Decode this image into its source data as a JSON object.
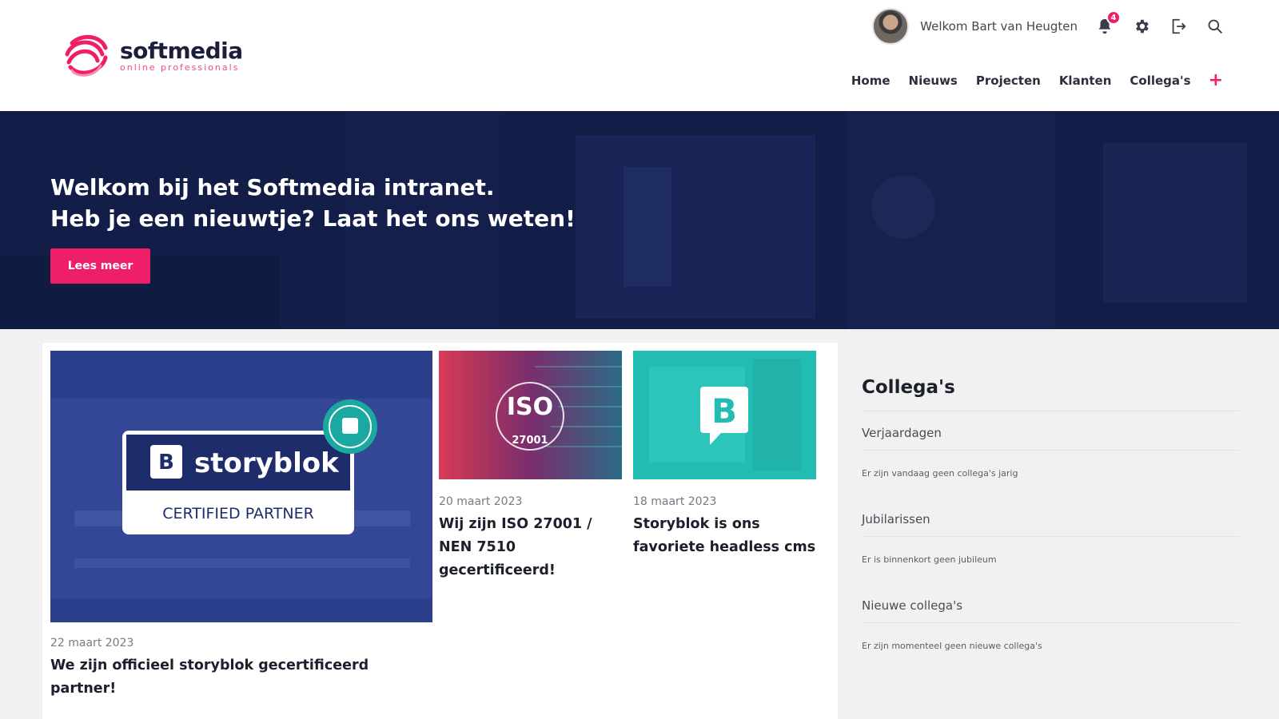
{
  "brand": {
    "name": "softmedia",
    "tagline": "online professionals",
    "accent": "#ef1e68",
    "navy": "#121d48"
  },
  "user": {
    "welcome": "Welkom Bart van Heugten",
    "notifications": "4"
  },
  "nav": {
    "items": [
      "Home",
      "Nieuws",
      "Projecten",
      "Klanten",
      "Collega's"
    ],
    "plus": "+"
  },
  "hero": {
    "line1": "Welkom bij het Softmedia intranet.",
    "line2": "Heb je een nieuwtje? Laat het ons weten!",
    "button": "Lees meer"
  },
  "news": [
    {
      "date": "22 maart 2023",
      "title": "We zijn officieel storyblok gecertificeerd partner!",
      "image_brand": "storyblok",
      "image_caption": "CERTIFIED PARTNER"
    },
    {
      "date": "20 maart 2023",
      "title": "Wij zijn ISO 27001 / NEN 7510 gecertificeerd!",
      "image_brand": "ISO",
      "image_caption": "27001"
    },
    {
      "date": "18 maart 2023",
      "title": "Storyblok is ons favoriete headless cms",
      "image_brand": "B"
    }
  ],
  "sidebar": {
    "title": "Collega's",
    "sections": [
      {
        "label": "Verjaardagen",
        "empty": "Er zijn vandaag geen collega's jarig"
      },
      {
        "label": "Jubilarissen",
        "empty": "Er is binnenkort geen jubileum"
      },
      {
        "label": "Nieuwe collega's",
        "empty": "Er zijn momenteel geen nieuwe collega's"
      }
    ]
  }
}
